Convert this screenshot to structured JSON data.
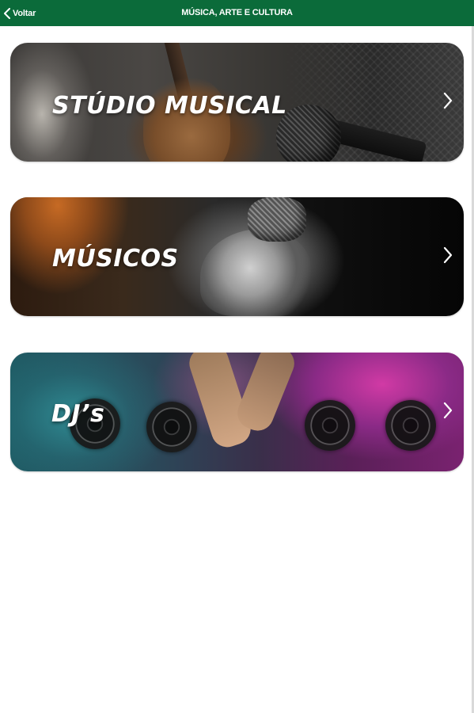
{
  "header": {
    "back_label": "Voltar",
    "title": "MÚSICA, ARTE E CULTURA",
    "background_color": "#0b6b3a"
  },
  "cards": [
    {
      "label": "STÚDIO MUSICAL",
      "icon": "chevron-right-icon"
    },
    {
      "label": "MÚSICOS",
      "icon": "chevron-right-icon"
    },
    {
      "label": "DJ’s",
      "icon": "chevron-right-icon"
    }
  ]
}
